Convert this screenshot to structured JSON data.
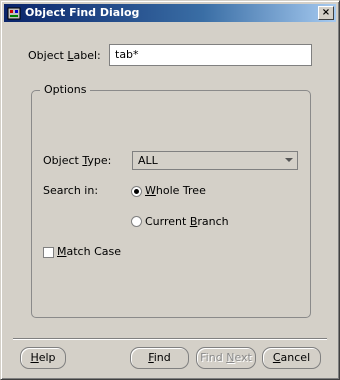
{
  "window": {
    "title": "Object Find Dialog",
    "close_glyph": "×"
  },
  "form": {
    "object_label": {
      "label_pre": "Object ",
      "label_mnemonic": "L",
      "label_post": "abel:",
      "value": "tab*"
    },
    "options": {
      "group_title": "Options",
      "object_type": {
        "label_pre": "Object ",
        "label_mnemonic": "T",
        "label_post": "ype:",
        "selected": "ALL"
      },
      "search_in": {
        "label": "Search in:",
        "choices": [
          {
            "pre": "",
            "mnemonic": "W",
            "post": "hole Tree",
            "checked": true
          },
          {
            "pre": "Current ",
            "mnemonic": "B",
            "post": "ranch",
            "checked": false
          }
        ]
      },
      "match_case": {
        "pre": "",
        "mnemonic": "M",
        "post": "atch Case",
        "checked": false
      }
    }
  },
  "buttons": {
    "help": {
      "pre": "",
      "mnemonic": "H",
      "post": "elp"
    },
    "find": {
      "pre": "",
      "mnemonic": "F",
      "post": "ind"
    },
    "find_next": {
      "pre": "Find ",
      "mnemonic": "N",
      "post": "ext"
    },
    "cancel": {
      "pre": "",
      "mnemonic": "C",
      "post": "ancel"
    }
  },
  "colors": {
    "dialog_bg": "#d4d0c8",
    "title_bar": "#0a246a",
    "disabled_text": "#8a8a8a"
  },
  "icons": [
    "app-icon",
    "close-icon",
    "dropdown-arrow-icon"
  ]
}
